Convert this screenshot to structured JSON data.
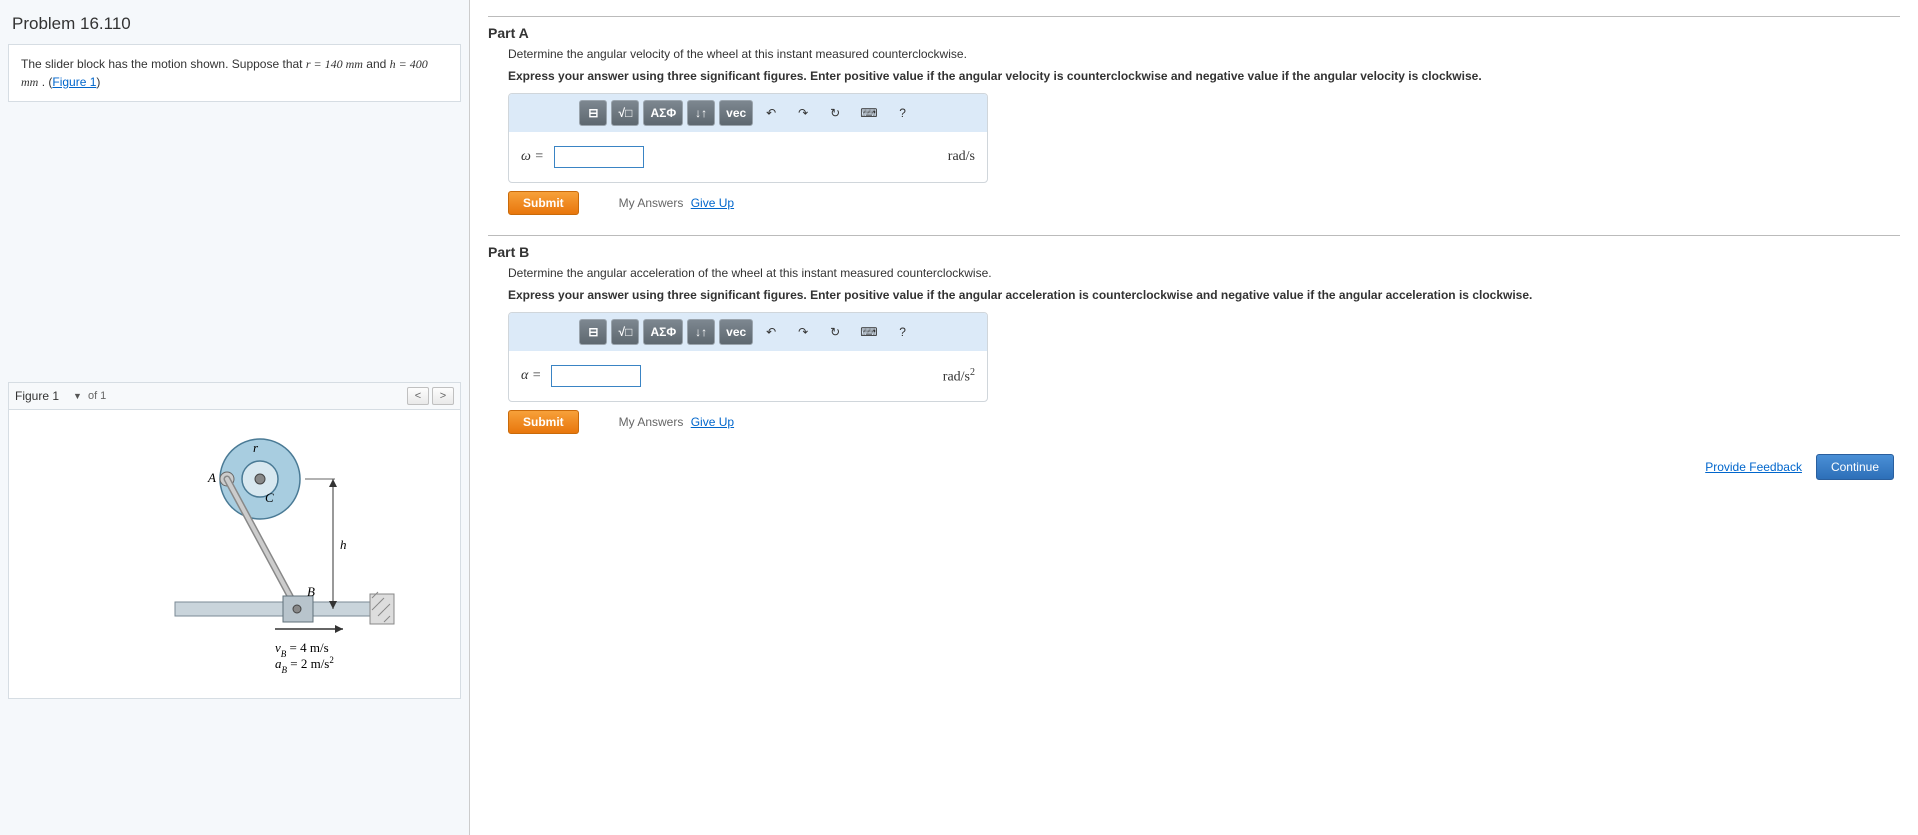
{
  "problem": {
    "title": "Problem 16.110",
    "description_prefix": "The slider block has the motion shown. Suppose that ",
    "r_expr": "r = 140  mm",
    "middle": " and ",
    "h_expr": "h = 400  mm",
    "suffix": " . (",
    "figure_link": "Figure 1",
    "suffix2": ")"
  },
  "figure": {
    "label": "Figure 1",
    "of_text": "of 1",
    "labels": {
      "A": "A",
      "r": "r",
      "C": "C",
      "h": "h",
      "B": "B"
    },
    "velocity_line": "v_B = 4 m/s",
    "accel_line": "a_B = 2 m/s²"
  },
  "partA": {
    "title": "Part A",
    "prompt": "Determine the angular velocity of the wheel at this instant measured counterclockwise.",
    "hint": "Express your answer using three significant figures. Enter positive value if the angular velocity is counterclockwise and negative value if the angular velocity is clockwise.",
    "var_label": "ω =",
    "units": "rad/s"
  },
  "partB": {
    "title": "Part B",
    "prompt": "Determine the angular acceleration of the wheel at this instant measured counterclockwise.",
    "hint": "Express your answer using three significant figures. Enter positive value if the angular acceleration is counterclockwise and negative value if the angular acceleration is clockwise.",
    "var_label": "α =",
    "units_base": "rad/s",
    "units_sup": "2"
  },
  "toolbar": {
    "template": "⊟",
    "sqrt": "√□",
    "greek": "ΑΣΦ",
    "arrows": "↓↑",
    "vec": "vec",
    "undo": "↶",
    "redo": "↷",
    "reset": "↻",
    "keyboard": "⌨",
    "help": "?"
  },
  "actions": {
    "submit": "Submit",
    "my_answers": "My Answers",
    "give_up": "Give Up",
    "feedback": "Provide Feedback",
    "continue": "Continue"
  }
}
